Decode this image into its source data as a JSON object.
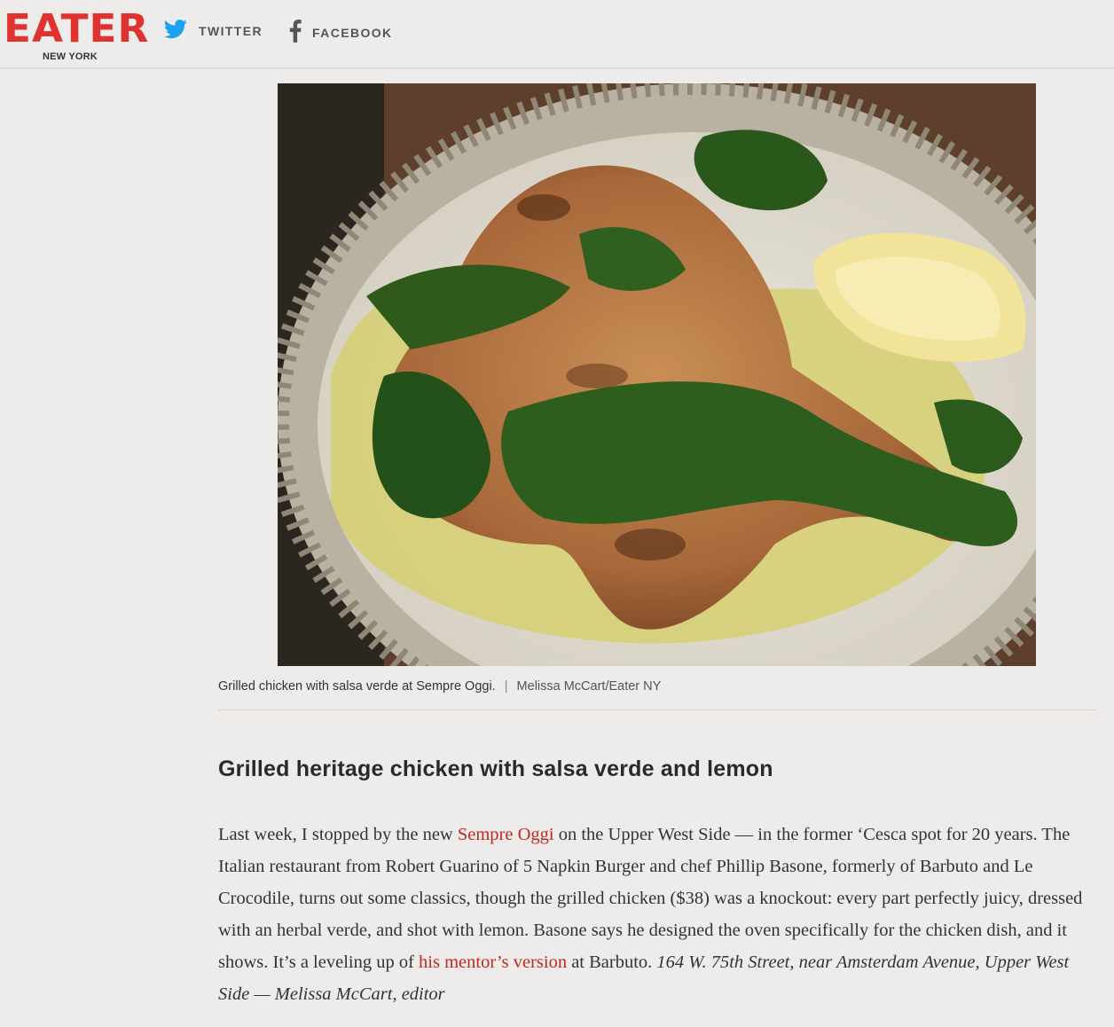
{
  "header": {
    "logo_text": "EATER",
    "logo_subtext": "NEW YORK",
    "social": [
      {
        "label": "TWITTER",
        "icon": "twitter-bird-icon",
        "color": "#1da1f2"
      },
      {
        "label": "FACEBOOK",
        "icon": "facebook-f-icon",
        "color": "#555555"
      }
    ],
    "brand_color": "#e0332f"
  },
  "photo": {
    "caption": "Grilled chicken with salsa verde at Sempre Oggi.",
    "separator": "|",
    "credit": "Melissa McCart/Eater NY"
  },
  "article": {
    "headline": "Grilled heritage chicken with salsa verde and lemon",
    "para_1": "Last week, I stopped by the new ",
    "link_1": "Sempre Oggi",
    "para_2": " on the Upper West Side — in the former ‘Cesca spot for 20 years. The Italian restaurant from Robert Guarino of 5 Napkin Burger and chef Phillip Basone, formerly of Barbuto and Le Crocodile, turns out some classics, though the grilled chicken ($38) was a knockout: every part perfectly juicy, dressed with an herbal verde, and shot with lemon. Basone says he designed the oven specifically for the chicken dish, and it shows. It’s a leveling up of ",
    "link_2": "his mentor’s version",
    "para_3": " at Barbuto. ",
    "address_italic": "164 W. 75th Street, near Amsterdam Avenue, Upper West Side — Melissa McCart, editor",
    "link_color": "#c8261e"
  }
}
